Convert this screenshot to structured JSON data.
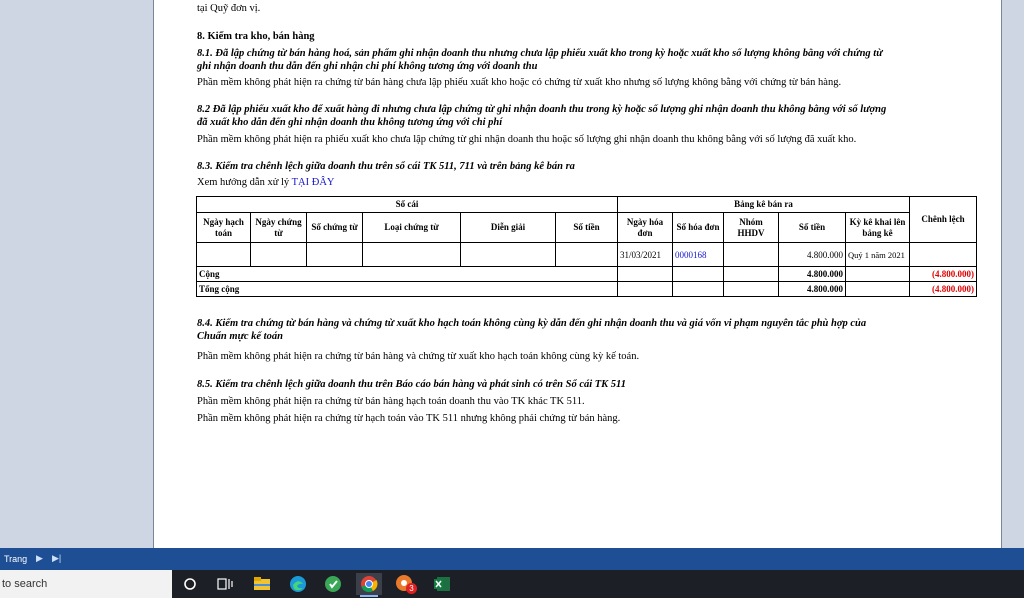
{
  "document": {
    "prev_line": "tại Quỹ đơn vị.",
    "section8_title": "8. Kiểm tra kho, bán hàng",
    "s81_title_line1": "8.1. Đã lập chứng từ bán hàng hoá, sản phẩm ghi nhận doanh thu nhưng chưa lập phiếu xuất kho trong kỳ hoặc xuất kho số lượng không bằng với chứng từ",
    "s81_title_line2": "ghi nhận doanh thu dẫn đến ghi nhận chi phí không tương ứng với doanh thu",
    "s81_text": "Phần mềm không phát hiện ra chứng từ bán hàng chưa lập phiếu xuất kho hoặc có chứng từ xuất kho nhưng số lượng không bằng với chứng từ bán hàng.",
    "s82_title_line1": "8.2 Đã lập phiếu xuất kho để xuất hàng đi nhưng chưa lập chứng từ ghi nhận doanh thu trong kỳ hoặc số lượng ghi nhận doanh thu không bằng với số lượng",
    "s82_title_line2": "đã xuất kho dẫn đến ghi nhận doanh thu không tương ứng với chi phí",
    "s82_text": "Phần mềm không phát hiện ra phiếu xuất kho chưa lập chứng từ ghi nhận doanh thu hoặc số lượng ghi nhận doanh thu không bằng với số lượng đã xuất kho.",
    "s83_title": "8.3. Kiểm tra chênh lệch giữa doanh thu trên sổ cái TK 511, 711 và trên bảng kê bán ra",
    "s83_hint_prefix": "Xem hướng dẫn xử lý",
    "s83_hint_link": "TẠI ĐÂY",
    "s84_title_line1": "8.4. Kiểm tra chứng từ bán hàng và chứng từ xuất kho hạch toán không cùng kỳ dẫn đến ghi nhận doanh thu và giá vốn vi phạm nguyên tắc phù hợp của",
    "s84_title_line2": "Chuẩn mực kế toán",
    "s84_text": "Phần mềm không phát hiện ra chứng từ bán hàng và chứng từ xuất kho hạch toán không cùng kỳ kế toán.",
    "s85_title": "8.5. Kiểm tra chênh lệch giữa doanh thu trên Báo cáo bán hàng và phát sinh có trên Sổ cái TK 511",
    "s85_text1": "Phần mềm không phát hiện ra chứng từ bán hàng hạch toán doanh thu vào TK khác TK 511.",
    "s85_text2": "Phần mềm không phát hiện ra chứng từ hạch toán vào TK 511 nhưng không phải chứng từ bán hàng."
  },
  "table": {
    "group_so_cai": "Sổ cái",
    "group_bang_ke": "Bảng kê bán ra",
    "col_chenh_lech": "Chênh lệch",
    "col_ngay_hach_toan": "Ngày hạch toán",
    "col_ngay_chung_tu": "Ngày chứng từ",
    "col_so_chung_tu": "Số chứng từ",
    "col_loai_chung_tu": "Loại chứng từ",
    "col_dien_giai": "Diễn giải",
    "col_so_tien": "Số tiền",
    "col_ngay_hoa_don": "Ngày hóa đơn",
    "col_so_hoa_don": "Số hóa đơn",
    "col_nhom_hhdv": "Nhóm HHDV",
    "col_so_tien_bk": "Số tiền",
    "col_ky_ke_khai": "Kỳ kê khai lên bảng kê",
    "row1": {
      "ngay_hoa_don": "31/03/2021",
      "so_hoa_don": "0000168",
      "so_tien": "4.800.000",
      "ky_ke_khai": "Quý 1 năm 2021"
    },
    "cong_label": "Cộng",
    "cong_so_tien": "4.800.000",
    "cong_chenh_lech": "(4.800.000)",
    "tong_label": "Tổng cộng",
    "tong_so_tien": "4.800.000",
    "tong_chenh_lech": "(4.800.000)"
  },
  "statusbar": {
    "page_label": "Trang"
  },
  "taskbar": {
    "search_placeholder": "to search",
    "chrome_badge": "3"
  },
  "colors": {
    "link": "#1515cc",
    "negative": "#e00000",
    "statusbar": "#1e4f95",
    "taskbar": "#1c1f26"
  }
}
